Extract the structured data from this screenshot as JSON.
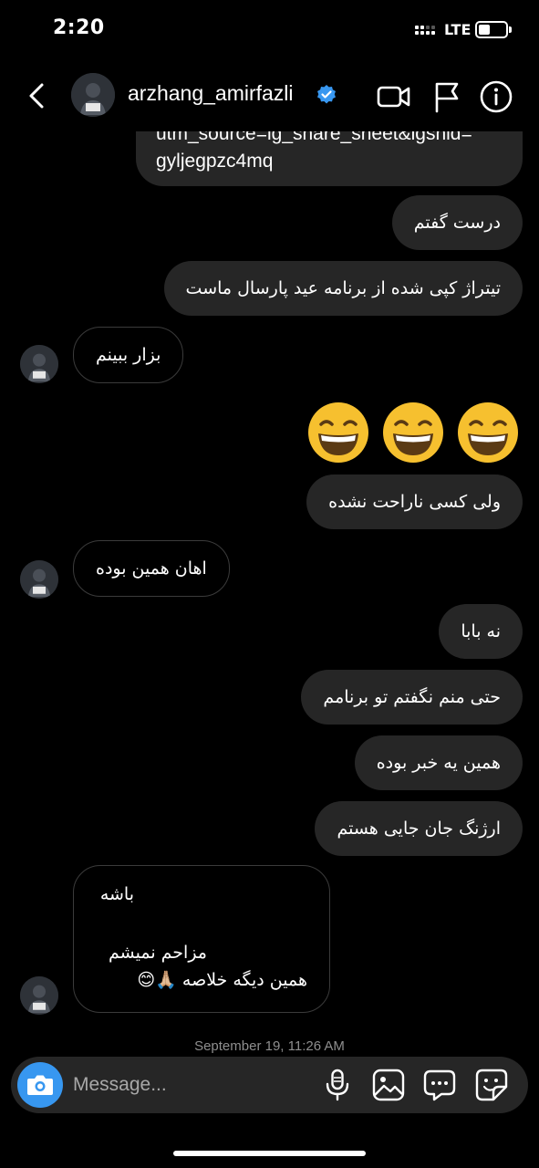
{
  "status_bar": {
    "time": "2:20",
    "network": "LTE"
  },
  "header": {
    "username": "arzhang_amirfazli",
    "verified": true
  },
  "messages": {
    "link_tail_1": "utm_source=ig_share_sheet&igshid=",
    "link_tail_2": "gyljegpzc4mq",
    "m1": "درست گفتم",
    "m2": "تیتراژ کپی شده از برنامه عید پارسال ماست",
    "m3": "بزار ببینم",
    "m4_emoji": "😄😄😄",
    "m5": "ولی کسی ناراحت نشده",
    "m6": "اهان همین بوده",
    "m7": "نه بابا",
    "m8": "حتی منم نگفتم تو برنامم",
    "m9": "همین یه خبر بوده",
    "m10": "ارژنگ جان جایی هستم",
    "m11_line1": "باشه",
    "m11_line2": "مزاحم نمیشم",
    "m11_line3": "همین دیگه خلاصه 🙏🏼😊"
  },
  "timestamp": "September 19, 11:26 AM",
  "composer": {
    "placeholder": "Message..."
  },
  "colors": {
    "sent_bubble": "#262626",
    "received_border": "#3b3b3b",
    "camera": "#3797f0",
    "verified": "#3897f0"
  },
  "icons": [
    "back-icon",
    "verified-icon",
    "video-call-icon",
    "flag-icon",
    "info-icon",
    "camera-icon",
    "microphone-icon",
    "gallery-icon",
    "chat-bubble-icon",
    "sticker-icon"
  ]
}
